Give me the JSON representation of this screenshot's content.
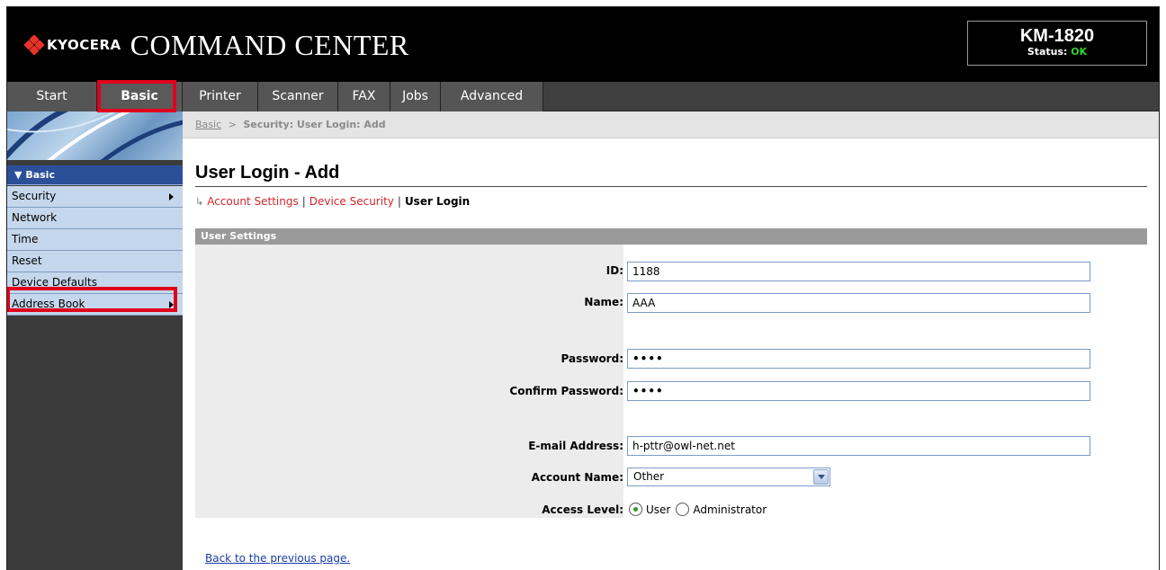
{
  "header": {
    "brand": "KYOCERA",
    "title": "COMMAND CENTER",
    "model": "KM-1820",
    "status_label": "Status:",
    "status_value": "OK"
  },
  "nav": {
    "tabs": [
      {
        "label": "Start"
      },
      {
        "label": "Basic"
      },
      {
        "label": "Printer"
      },
      {
        "label": "Scanner"
      },
      {
        "label": "FAX"
      },
      {
        "label": "Jobs"
      },
      {
        "label": "Advanced"
      }
    ]
  },
  "sidebar": {
    "section": "Basic",
    "items": [
      {
        "label": "Security"
      },
      {
        "label": "Network"
      },
      {
        "label": "Time"
      },
      {
        "label": "Reset"
      },
      {
        "label": "Device Defaults"
      },
      {
        "label": "Address Book"
      }
    ]
  },
  "breadcrumb": {
    "root": "Basic",
    "separator": ">",
    "current": "Security: User Login: Add"
  },
  "page": {
    "title": "User Login - Add",
    "sublinks": {
      "account_settings": "Account Settings",
      "device_security": "Device Security",
      "user_login": "User Login",
      "separator": "|"
    },
    "section_title": "User Settings",
    "back_link": "Back to the previous page."
  },
  "form": {
    "id_label": "ID:",
    "id_value": "1188",
    "name_label": "Name:",
    "name_value": "AAA",
    "password_label": "Password:",
    "password_value": "••••",
    "confirm_label": "Confirm Password:",
    "confirm_value": "••••",
    "email_label": "E-mail Address:",
    "email_value": "h-pttr@owl-net.net",
    "account_label": "Account Name:",
    "account_value": "Other",
    "access_label": "Access Level:",
    "access_user": "User",
    "access_admin": "Administrator"
  },
  "colors": {
    "highlight": "#e0001b",
    "status_ok": "#37d130",
    "link_red": "#d2262e"
  }
}
